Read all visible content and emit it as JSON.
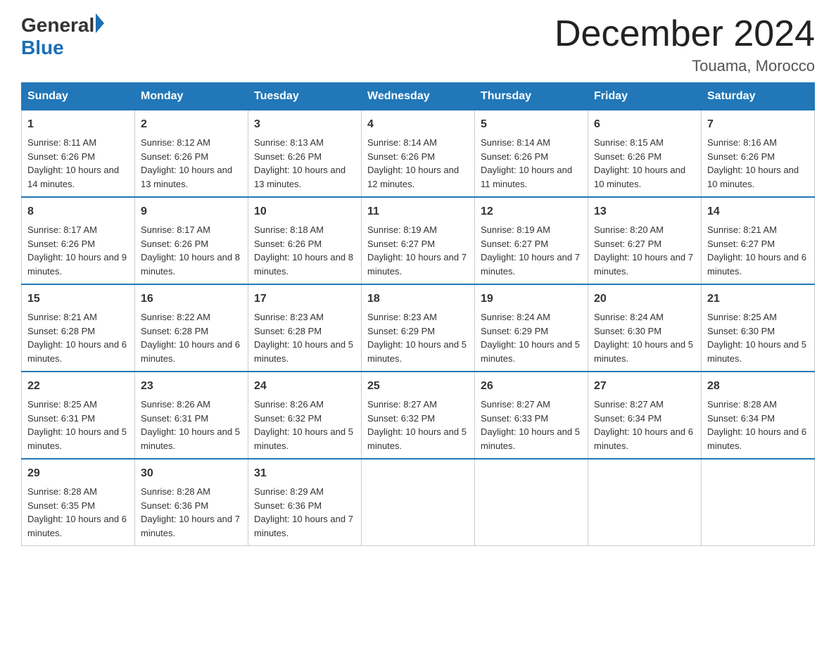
{
  "header": {
    "logo_general": "General",
    "logo_blue": "Blue",
    "title": "December 2024",
    "subtitle": "Touama, Morocco"
  },
  "weekdays": [
    "Sunday",
    "Monday",
    "Tuesday",
    "Wednesday",
    "Thursday",
    "Friday",
    "Saturday"
  ],
  "weeks": [
    [
      {
        "day": "1",
        "sunrise": "8:11 AM",
        "sunset": "6:26 PM",
        "daylight": "10 hours and 14 minutes."
      },
      {
        "day": "2",
        "sunrise": "8:12 AM",
        "sunset": "6:26 PM",
        "daylight": "10 hours and 13 minutes."
      },
      {
        "day": "3",
        "sunrise": "8:13 AM",
        "sunset": "6:26 PM",
        "daylight": "10 hours and 13 minutes."
      },
      {
        "day": "4",
        "sunrise": "8:14 AM",
        "sunset": "6:26 PM",
        "daylight": "10 hours and 12 minutes."
      },
      {
        "day": "5",
        "sunrise": "8:14 AM",
        "sunset": "6:26 PM",
        "daylight": "10 hours and 11 minutes."
      },
      {
        "day": "6",
        "sunrise": "8:15 AM",
        "sunset": "6:26 PM",
        "daylight": "10 hours and 10 minutes."
      },
      {
        "day": "7",
        "sunrise": "8:16 AM",
        "sunset": "6:26 PM",
        "daylight": "10 hours and 10 minutes."
      }
    ],
    [
      {
        "day": "8",
        "sunrise": "8:17 AM",
        "sunset": "6:26 PM",
        "daylight": "10 hours and 9 minutes."
      },
      {
        "day": "9",
        "sunrise": "8:17 AM",
        "sunset": "6:26 PM",
        "daylight": "10 hours and 8 minutes."
      },
      {
        "day": "10",
        "sunrise": "8:18 AM",
        "sunset": "6:26 PM",
        "daylight": "10 hours and 8 minutes."
      },
      {
        "day": "11",
        "sunrise": "8:19 AM",
        "sunset": "6:27 PM",
        "daylight": "10 hours and 7 minutes."
      },
      {
        "day": "12",
        "sunrise": "8:19 AM",
        "sunset": "6:27 PM",
        "daylight": "10 hours and 7 minutes."
      },
      {
        "day": "13",
        "sunrise": "8:20 AM",
        "sunset": "6:27 PM",
        "daylight": "10 hours and 7 minutes."
      },
      {
        "day": "14",
        "sunrise": "8:21 AM",
        "sunset": "6:27 PM",
        "daylight": "10 hours and 6 minutes."
      }
    ],
    [
      {
        "day": "15",
        "sunrise": "8:21 AM",
        "sunset": "6:28 PM",
        "daylight": "10 hours and 6 minutes."
      },
      {
        "day": "16",
        "sunrise": "8:22 AM",
        "sunset": "6:28 PM",
        "daylight": "10 hours and 6 minutes."
      },
      {
        "day": "17",
        "sunrise": "8:23 AM",
        "sunset": "6:28 PM",
        "daylight": "10 hours and 5 minutes."
      },
      {
        "day": "18",
        "sunrise": "8:23 AM",
        "sunset": "6:29 PM",
        "daylight": "10 hours and 5 minutes."
      },
      {
        "day": "19",
        "sunrise": "8:24 AM",
        "sunset": "6:29 PM",
        "daylight": "10 hours and 5 minutes."
      },
      {
        "day": "20",
        "sunrise": "8:24 AM",
        "sunset": "6:30 PM",
        "daylight": "10 hours and 5 minutes."
      },
      {
        "day": "21",
        "sunrise": "8:25 AM",
        "sunset": "6:30 PM",
        "daylight": "10 hours and 5 minutes."
      }
    ],
    [
      {
        "day": "22",
        "sunrise": "8:25 AM",
        "sunset": "6:31 PM",
        "daylight": "10 hours and 5 minutes."
      },
      {
        "day": "23",
        "sunrise": "8:26 AM",
        "sunset": "6:31 PM",
        "daylight": "10 hours and 5 minutes."
      },
      {
        "day": "24",
        "sunrise": "8:26 AM",
        "sunset": "6:32 PM",
        "daylight": "10 hours and 5 minutes."
      },
      {
        "day": "25",
        "sunrise": "8:27 AM",
        "sunset": "6:32 PM",
        "daylight": "10 hours and 5 minutes."
      },
      {
        "day": "26",
        "sunrise": "8:27 AM",
        "sunset": "6:33 PM",
        "daylight": "10 hours and 5 minutes."
      },
      {
        "day": "27",
        "sunrise": "8:27 AM",
        "sunset": "6:34 PM",
        "daylight": "10 hours and 6 minutes."
      },
      {
        "day": "28",
        "sunrise": "8:28 AM",
        "sunset": "6:34 PM",
        "daylight": "10 hours and 6 minutes."
      }
    ],
    [
      {
        "day": "29",
        "sunrise": "8:28 AM",
        "sunset": "6:35 PM",
        "daylight": "10 hours and 6 minutes."
      },
      {
        "day": "30",
        "sunrise": "8:28 AM",
        "sunset": "6:36 PM",
        "daylight": "10 hours and 7 minutes."
      },
      {
        "day": "31",
        "sunrise": "8:29 AM",
        "sunset": "6:36 PM",
        "daylight": "10 hours and 7 minutes."
      },
      null,
      null,
      null,
      null
    ]
  ]
}
